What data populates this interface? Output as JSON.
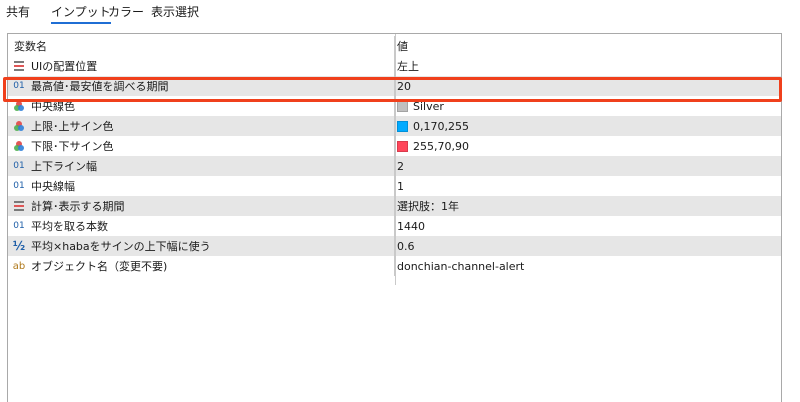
{
  "tabs": [
    {
      "label": "共有",
      "active": false
    },
    {
      "label": "インプット",
      "active": true
    },
    {
      "label": "カラー",
      "active": false
    },
    {
      "label": "表示選択",
      "active": false
    }
  ],
  "header": {
    "name": "変数名",
    "value": "値"
  },
  "rows": [
    {
      "icon": "enum-list-icon",
      "name": "UIの配置位置",
      "value": "左上"
    },
    {
      "icon": "integer-icon",
      "icon_text": "01",
      "name": "最高値･最安値を調べる期間",
      "value": "20",
      "highlighted": true
    },
    {
      "icon": "color-icon",
      "name": "中央線色",
      "value": "Silver",
      "swatch": "#c0c0c0"
    },
    {
      "icon": "color-icon",
      "name": "上限･上サイン色",
      "value": "0,170,255",
      "swatch": "#00aaff"
    },
    {
      "icon": "color-icon",
      "name": "下限･下サイン色",
      "value": "255,70,90",
      "swatch": "#ff465a"
    },
    {
      "icon": "integer-icon",
      "icon_text": "01",
      "name": "上下ライン幅",
      "value": "2"
    },
    {
      "icon": "integer-icon",
      "icon_text": "01",
      "name": "中央線幅",
      "value": "1"
    },
    {
      "icon": "enum-list-icon",
      "name": "計算･表示する期間",
      "value": "選択肢：1年"
    },
    {
      "icon": "integer-icon",
      "icon_text": "01",
      "name": "平均を取る本数",
      "value": "1440"
    },
    {
      "icon": "fraction-icon",
      "icon_text": "½",
      "name": "平均×habaをサインの上下幅に使う",
      "value": "0.6"
    },
    {
      "icon": "string-icon",
      "icon_text": "ab",
      "name": "オブジェクト名（変更不要)",
      "value": "donchian-channel-alert"
    }
  ],
  "colors": {
    "accent": "#1f6ed4",
    "highlight_border": "#f0401c",
    "alt_row": "#e6e6e6"
  }
}
